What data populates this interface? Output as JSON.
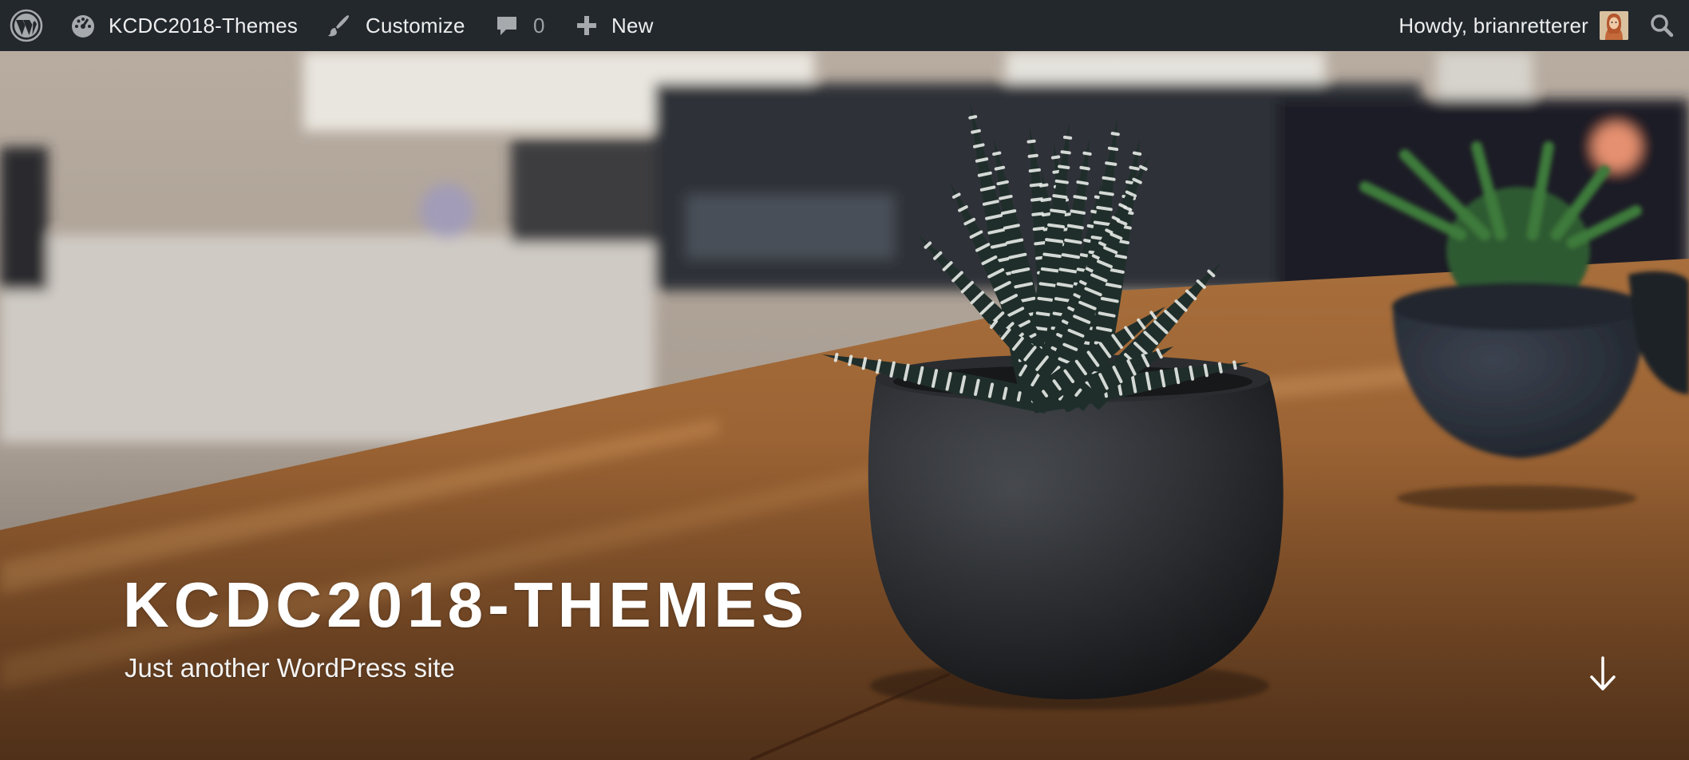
{
  "admin_bar": {
    "wp_logo_icon": "wordpress-logo-icon",
    "site_name": "KCDC2018-Themes",
    "site_icon": "dashboard-icon",
    "customize": "Customize",
    "customize_icon": "paintbrush-icon",
    "comments_count": "0",
    "comments_icon": "comment-bubble-icon",
    "new": "New",
    "new_icon": "plus-icon",
    "greeting": "Howdy, brianretterer",
    "search_icon": "search-icon",
    "colors": {
      "bar_bg": "#23282d",
      "text": "#eeeeee",
      "muted": "#9ca2a7"
    }
  },
  "header": {
    "site_title": "KCDC2018-THEMES",
    "site_description": "Just another WordPress site",
    "scroll_icon": "arrow-down-icon"
  }
}
